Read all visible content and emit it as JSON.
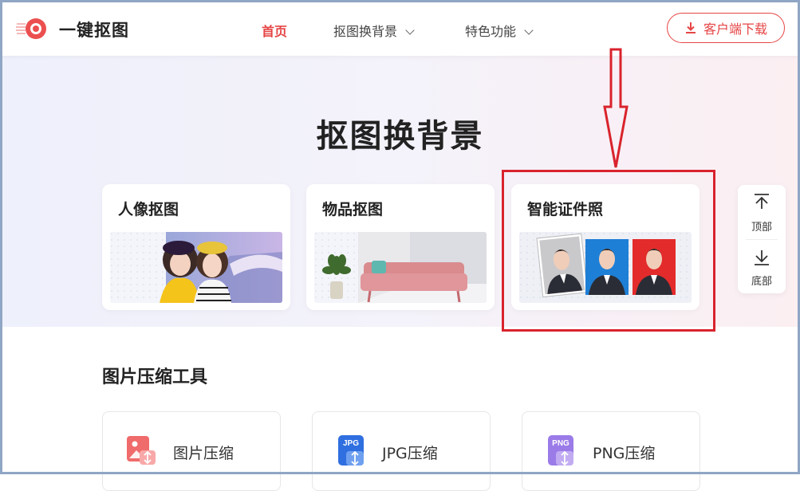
{
  "brand": {
    "name": "一键抠图",
    "accent": "#e64545"
  },
  "nav": {
    "home": "首页",
    "items": [
      {
        "label": "抠图换背景",
        "icon": "chevron-down-icon"
      },
      {
        "label": "特色功能",
        "icon": "chevron-down-icon"
      }
    ],
    "download_label": "客户端下载"
  },
  "hero": {
    "title": "抠图换背景",
    "cards": [
      {
        "title": "人像抠图"
      },
      {
        "title": "物品抠图"
      },
      {
        "title": "智能证件照"
      }
    ]
  },
  "side": {
    "top_label": "顶部",
    "bottom_label": "底部"
  },
  "tools": {
    "title": "图片压缩工具",
    "items": [
      {
        "label": "图片压缩",
        "icon": "image-compress-icon"
      },
      {
        "label": "JPG压缩",
        "icon_text": "JPG"
      },
      {
        "label": "PNG压缩",
        "icon_text": "PNG"
      }
    ]
  },
  "annotation": {
    "color": "#d9232d"
  }
}
